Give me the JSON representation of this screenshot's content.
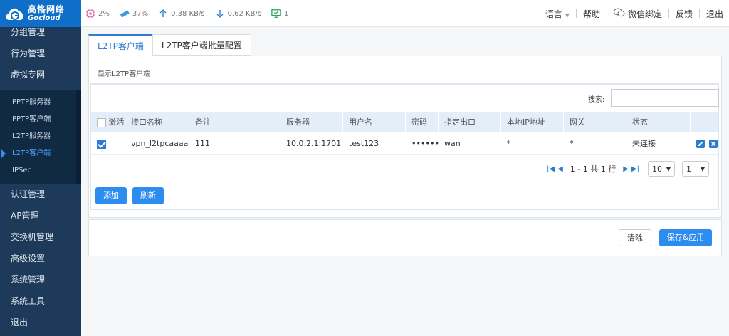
{
  "brand": {
    "name_cn": "高恪网络",
    "name_en": "Gocloud",
    "color": "#0f6fc8"
  },
  "status": {
    "cpu": "2%",
    "memory": "37%",
    "upload": "0.38 KB/s",
    "download": "0.62 KB/s",
    "online": "1"
  },
  "header_links": {
    "language": "语言",
    "help": "帮助",
    "wechat": "微信绑定",
    "feedback": "反馈",
    "logout": "退出"
  },
  "sidebar": {
    "items_top": [
      "分组管理",
      "行为管理",
      "虚拟专网"
    ],
    "submenu": [
      "PPTP服务器",
      "PPTP客户端",
      "L2TP服务器",
      "L2TP客户端",
      "IPSec"
    ],
    "items_bottom": [
      "认证管理",
      "AP管理",
      "交换机管理",
      "高级设置",
      "系统管理",
      "系统工具",
      "退出"
    ]
  },
  "tabs": [
    "L2TP客户端",
    "L2TP客户端批量配置"
  ],
  "panel": {
    "title": "显示L2TP客户端",
    "search_label": "搜索:"
  },
  "table": {
    "headers": [
      "激活",
      "接口名称",
      "备注",
      "服务器",
      "用户名",
      "密码",
      "指定出口",
      "本地IP地址",
      "网关",
      "状态"
    ],
    "rows": [
      [
        "vpn_l2tpcaaaa",
        "111",
        "10.0.2.1:1701",
        "test123",
        "••••••",
        "wan",
        "*",
        "*",
        "未连接"
      ]
    ]
  },
  "pager": {
    "info": "1 - 1 共 1 行",
    "page_size": "10",
    "page": "1"
  },
  "buttons": {
    "add": "添加",
    "refresh": "刷新",
    "clear": "清除",
    "save_apply": "保存&应用"
  },
  "colors": {
    "accent": "#2d8cf0",
    "sidebar": "#1e3a5a"
  }
}
